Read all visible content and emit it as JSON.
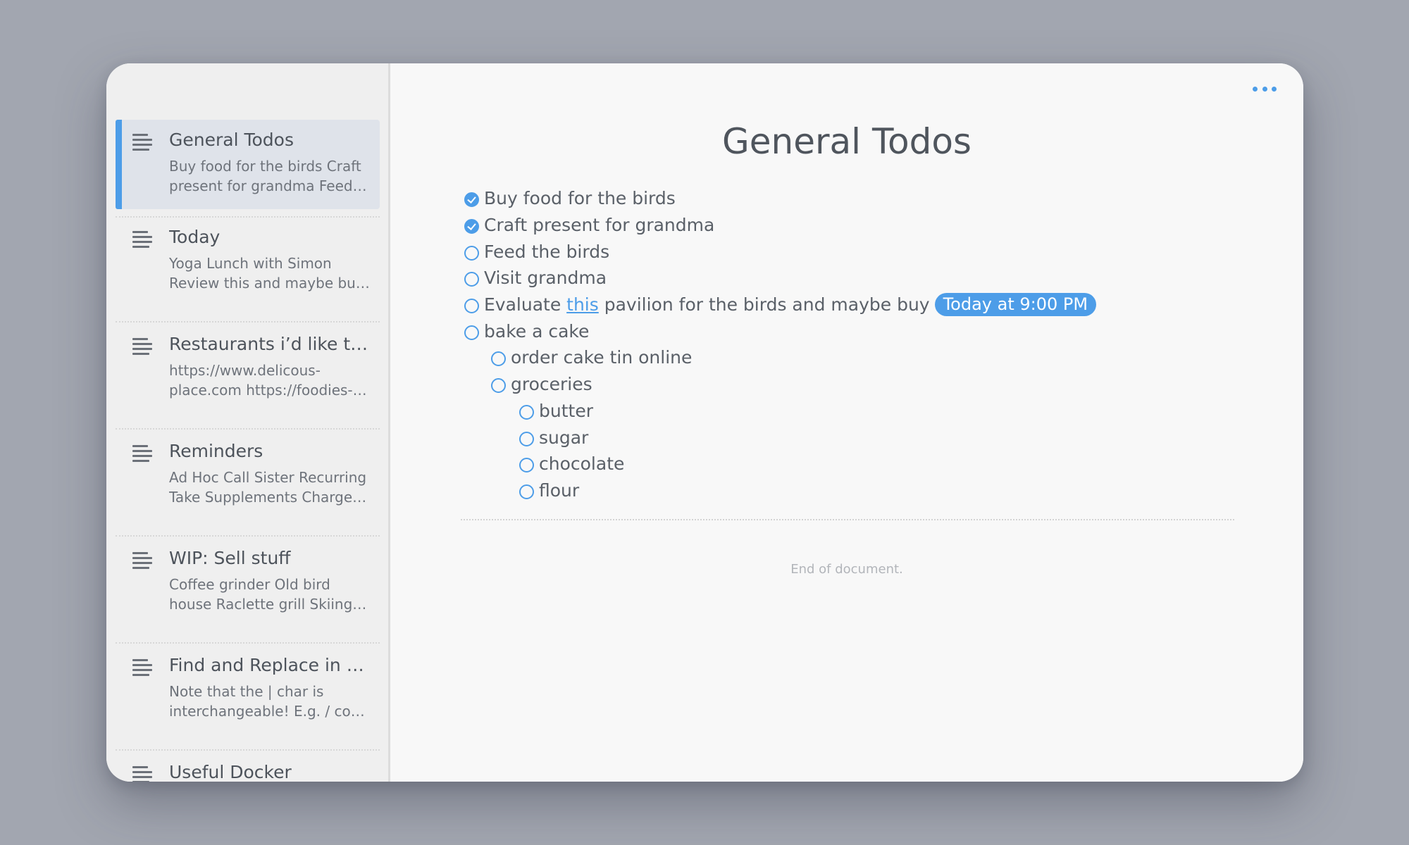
{
  "sidebar": {
    "notes": [
      {
        "title": "General Todos",
        "preview": "Buy food for the birds Craft present for grandma Feed the birds Visit grandma",
        "active": true
      },
      {
        "title": "Today",
        "preview": "Yoga Lunch with Simon Review this and maybe buy something"
      },
      {
        "title": "Restaurants i’d like to visit",
        "preview": "https://www.delicous-place.com https://foodies-place.com"
      },
      {
        "title": "Reminders",
        "preview": "Ad Hoc Call Sister Recurring Take Supplements Charge phone"
      },
      {
        "title": "WIP: Sell stuff",
        "preview": "Coffee grinder Old bird house Raclette grill Skiing boots"
      },
      {
        "title": "Find and Replace in a file",
        "preview": "Note that the | char is interchangeable! E.g. / could also be used"
      },
      {
        "title": "Useful Docker",
        "preview": ""
      }
    ]
  },
  "main": {
    "more_icon": "more-horizontal-icon",
    "title": "General Todos",
    "todos": [
      {
        "text": "Buy food for the birds",
        "checked": true,
        "level": 0
      },
      {
        "text": "Craft present for grandma",
        "checked": true,
        "level": 0
      },
      {
        "text": "Feed the birds",
        "checked": false,
        "level": 0
      },
      {
        "text": "Visit grandma",
        "checked": false,
        "level": 0
      },
      {
        "text_before": "Evaluate ",
        "link": "this",
        "text_after": " pavilion for the birds and maybe buy",
        "badge": "Today at 9:00 PM",
        "checked": false,
        "level": 0
      },
      {
        "text": "bake a cake",
        "checked": false,
        "level": 0
      },
      {
        "text": "order cake tin online",
        "checked": false,
        "level": 1
      },
      {
        "text": "groceries",
        "checked": false,
        "level": 1
      },
      {
        "text": "butter",
        "checked": false,
        "level": 2
      },
      {
        "text": "sugar",
        "checked": false,
        "level": 2
      },
      {
        "text": "chocolate",
        "checked": false,
        "level": 2
      },
      {
        "text": "flour",
        "checked": false,
        "level": 2
      }
    ],
    "end_text": "End of document."
  },
  "colors": {
    "accent": "#4d9de8",
    "background": "#a2a6b0",
    "sidebar": "#efefef",
    "active_item": "#dfe3ea"
  }
}
